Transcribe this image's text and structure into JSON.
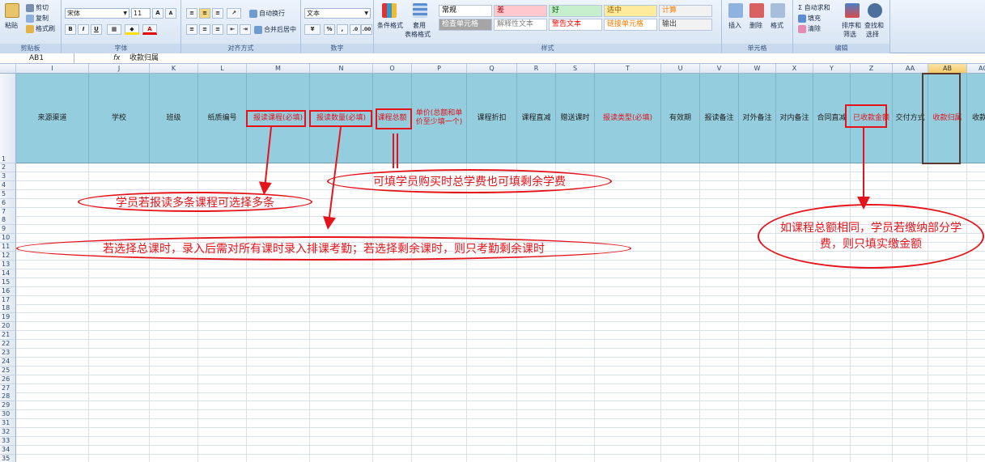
{
  "ribbon": {
    "clipboard": {
      "paste": "粘贴",
      "cut": "剪切",
      "copy": "复制",
      "format_painter": "格式刷",
      "label": "剪贴板"
    },
    "font": {
      "name": "宋体",
      "size": "11",
      "grow": "A",
      "shrink": "A",
      "bold": "B",
      "italic": "I",
      "underline": "U",
      "label": "字体"
    },
    "alignment": {
      "wrap": "自动换行",
      "merge": "合并后居中",
      "label": "对齐方式"
    },
    "number": {
      "format": "文本",
      "percent": "%",
      "comma": ",",
      "label": "数字"
    },
    "styles": {
      "conditional": "条件格式",
      "table": "套用",
      "table2": "表格格式",
      "cells": [
        {
          "text": "常规",
          "bg": "#ffffff",
          "fg": "#000000"
        },
        {
          "text": "差",
          "bg": "#ffc7ce",
          "fg": "#9c0006"
        },
        {
          "text": "好",
          "bg": "#c6efce",
          "fg": "#006100"
        },
        {
          "text": "适中",
          "bg": "#ffeb9c",
          "fg": "#9c5700"
        },
        {
          "text": "计算",
          "bg": "#f2f2f2",
          "fg": "#fa7d00"
        },
        {
          "text": "检查单元格",
          "bg": "#a5a5a5",
          "fg": "#ffffff"
        },
        {
          "text": "解释性文本",
          "bg": "#ffffff",
          "fg": "#7f7f7f"
        },
        {
          "text": "警告文本",
          "bg": "#ffffff",
          "fg": "#ff0000"
        },
        {
          "text": "链接单元格",
          "bg": "#ffffff",
          "fg": "#fa7d00"
        },
        {
          "text": "输出",
          "bg": "#f2f2f2",
          "fg": "#3f3f3f"
        }
      ],
      "label": "样式"
    },
    "cells_group": {
      "insert": "插入",
      "delete": "删除",
      "format": "格式",
      "label": "单元格"
    },
    "editing": {
      "autosum": "自动求和",
      "fill": "填充",
      "clear": "清除",
      "sort1": "排序和",
      "sort2": "筛选",
      "find1": "查找和",
      "find2": "选择",
      "label": "编辑"
    }
  },
  "formula_bar": {
    "name_box": "AB1",
    "fx": "fx",
    "content": "收款归属"
  },
  "columns": [
    {
      "letter": "I",
      "title": "来源渠道",
      "red": false
    },
    {
      "letter": "J",
      "title": "学校",
      "red": false
    },
    {
      "letter": "K",
      "title": "班级",
      "red": false
    },
    {
      "letter": "L",
      "title": "纸质编号",
      "red": false
    },
    {
      "letter": "M",
      "title": "报读课程(必填)",
      "red": true
    },
    {
      "letter": "N",
      "title": "报读数量(必填)",
      "red": true
    },
    {
      "letter": "O",
      "title": "课程总额",
      "red": true
    },
    {
      "letter": "P",
      "title": "单价(总额和单价至少填一个)",
      "red": true
    },
    {
      "letter": "Q",
      "title": "课程折扣",
      "red": false
    },
    {
      "letter": "R",
      "title": "课程直减",
      "red": false
    },
    {
      "letter": "S",
      "title": "赠送课时",
      "red": false
    },
    {
      "letter": "T",
      "title": "报读类型(必填)",
      "red": true
    },
    {
      "letter": "U",
      "title": "有效期",
      "red": false
    },
    {
      "letter": "V",
      "title": "报读备注",
      "red": false
    },
    {
      "letter": "W",
      "title": "对外备注",
      "red": false
    },
    {
      "letter": "X",
      "title": "对内备注",
      "red": false
    },
    {
      "letter": "Y",
      "title": "合同直减",
      "red": false
    },
    {
      "letter": "Z",
      "title": "已收款金额",
      "red": true
    },
    {
      "letter": "AA",
      "title": "交付方式",
      "red": false
    },
    {
      "letter": "AB",
      "title": "收款归属",
      "red": true
    },
    {
      "letter": "AC",
      "title": "收款凭",
      "red": false
    }
  ],
  "annotations": {
    "multi_course": "学员若报读多条课程可选择多条",
    "total_fee": "可填学员购买时总学费也可填剩余学费",
    "course_hours": "若选择总课时，录入后需对所有课时录入排课考勤；若选择剩余课时，则只考勤剩余课时",
    "partial_payment": "如课程总额相同，学员若缴纳部分学费，则只填实缴金额"
  }
}
